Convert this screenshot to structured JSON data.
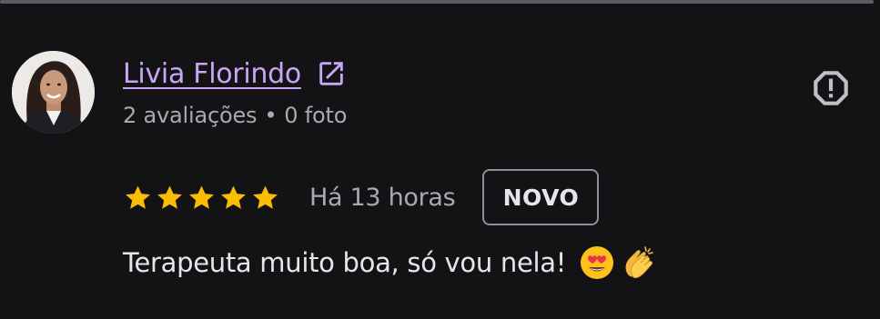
{
  "review": {
    "reviewer_name": "Livia Florindo",
    "review_count": "2 avaliações",
    "separator": "•",
    "photo_count": "0 foto",
    "rating": 5,
    "rating_max": 5,
    "time_ago": "Há 13 horas",
    "badge": "NOVO",
    "text": "Terapeuta muito boa, só vou nela!",
    "emojis": [
      "smiling-face-with-heart-eyes",
      "clapping-hands"
    ]
  },
  "icons": {
    "external_link": "external-link-icon",
    "report": "report-icon",
    "star": "star-icon"
  },
  "colors": {
    "background": "#131316",
    "name_link": "#c7a7f5",
    "secondary_text": "#a9aaaf",
    "primary_text": "#e6e6ea",
    "star": "#fbbc04",
    "badge_border": "#8f9095",
    "divider": "#5a5b60"
  }
}
